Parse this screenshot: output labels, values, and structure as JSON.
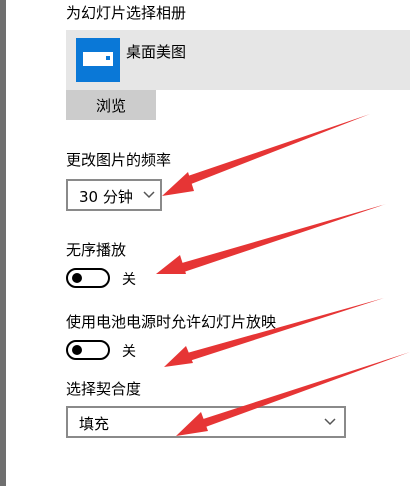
{
  "album": {
    "heading": "为幻灯片选择相册",
    "selected_name": "桌面美图",
    "browse_label": "浏览"
  },
  "interval": {
    "heading": "更改图片的频率",
    "value": "30 分钟"
  },
  "shuffle": {
    "heading": "无序播放",
    "state_label": "关"
  },
  "battery": {
    "heading": "使用电池电源时允许幻灯片放映",
    "state_label": "关"
  },
  "fit": {
    "heading": "选择契合度",
    "value": "填充"
  },
  "colors": {
    "accent": "#0a78d7",
    "annotation_arrow": "#e63535"
  }
}
